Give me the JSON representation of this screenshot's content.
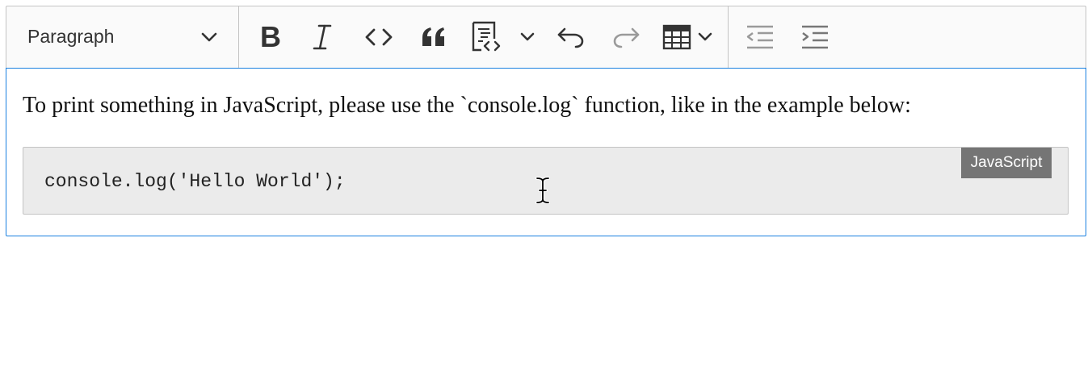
{
  "toolbar": {
    "heading_dropdown": {
      "selected": "Paragraph",
      "icon": "chevron-down-icon"
    },
    "buttons": [
      {
        "name": "bold",
        "icon": "bold-icon"
      },
      {
        "name": "italic",
        "icon": "italic-icon"
      },
      {
        "name": "code",
        "icon": "code-icon"
      },
      {
        "name": "block-quote",
        "icon": "quote-icon"
      },
      {
        "name": "insert-code-block",
        "icon": "code-block-icon"
      },
      {
        "name": "undo",
        "icon": "undo-icon"
      },
      {
        "name": "redo",
        "icon": "redo-icon",
        "disabled": true
      },
      {
        "name": "insert-table",
        "icon": "table-icon"
      },
      {
        "name": "outdent",
        "icon": "outdent-icon",
        "disabled": true
      },
      {
        "name": "indent",
        "icon": "indent-icon"
      }
    ]
  },
  "content": {
    "paragraph": "To print something in JavaScript, please use the `console.log` function, like in the example below:",
    "code_block": {
      "code": "console.log('Hello World');",
      "language": "JavaScript"
    }
  },
  "colors": {
    "focus_border": "#1a80e0",
    "toolbar_bg": "#fafafa",
    "code_bg": "#ebebeb",
    "badge_bg": "#757575",
    "disabled_icon": "#9a9a9a"
  }
}
